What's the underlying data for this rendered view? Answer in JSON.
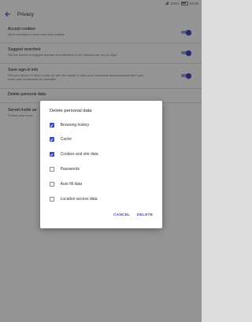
{
  "status": {
    "battery": "100%",
    "time": "15:05"
  },
  "appbar": {
    "title": "Privacy"
  },
  "settings": [
    {
      "title": "Accept cookies",
      "sub": "Allow websites to save and read cookies."
    },
    {
      "title": "Suggest searches",
      "sub": "Set the device to suggest queries and websites in the address bar as you type."
    },
    {
      "title": "Save sign-in info",
      "sub1": "Set your device to show a pop-up with the option to save your username and password when you",
      "sub2": "enter user credentials for websites."
    },
    {
      "title": "Delete personal data"
    },
    {
      "title": "Secret mode se",
      "sub": "Protect your brow"
    }
  ],
  "dialog": {
    "title": "Delete personal data",
    "options": [
      {
        "label": "Browsing history",
        "checked": true
      },
      {
        "label": "Cache",
        "checked": true
      },
      {
        "label": "Cookies and site data",
        "checked": true
      },
      {
        "label": "Passwords",
        "checked": false
      },
      {
        "label": "Auto fill data",
        "checked": false
      },
      {
        "label": "Location access data",
        "checked": false
      }
    ],
    "cancel": "CANCEL",
    "delete": "DELETE"
  },
  "colors": {
    "accent": "#3f47c5",
    "scrim": "rgba(0,0,0,0.42)"
  }
}
